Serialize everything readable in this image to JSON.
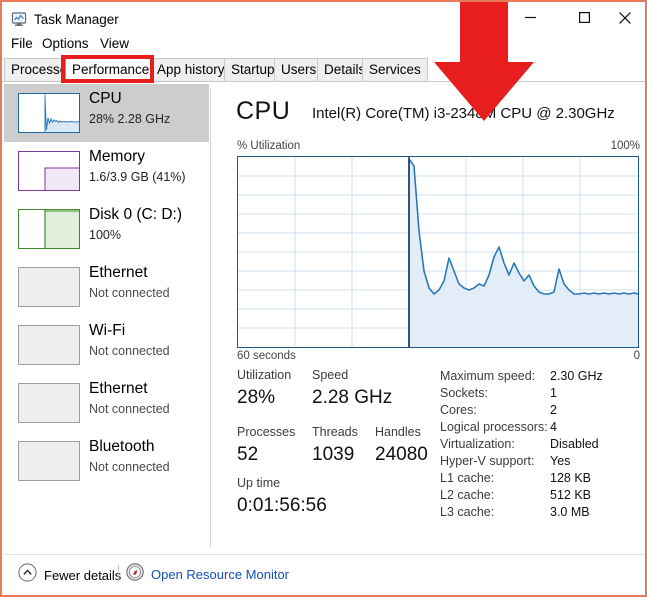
{
  "window": {
    "title": "Task Manager",
    "icon": "task-manager-icon",
    "border_color": "#e8795a",
    "controls": [
      {
        "name": "minimize",
        "glyph": "minimize-icon"
      },
      {
        "name": "maximize",
        "glyph": "maximize-icon"
      },
      {
        "name": "close",
        "glyph": "close-icon"
      }
    ]
  },
  "menubar": {
    "items": [
      {
        "label": "File"
      },
      {
        "label": "Options"
      },
      {
        "label": "View"
      }
    ]
  },
  "tabs": {
    "active": "Performance",
    "highlight_color": "#e81d1d",
    "items": [
      {
        "label": "Processes"
      },
      {
        "label": "Performance"
      },
      {
        "label": "App history"
      },
      {
        "label": "Startup"
      },
      {
        "label": "Users"
      },
      {
        "label": "Details"
      },
      {
        "label": "Services"
      }
    ]
  },
  "sidebar": {
    "items": [
      {
        "title": "CPU",
        "subtitle": "28%  2.28 GHz",
        "selected": true,
        "thumb": "cpu-graph-thumbnail",
        "accent": "#1f6aa5"
      },
      {
        "title": "Memory",
        "subtitle": "1.6/3.9 GB (41%)",
        "selected": false,
        "thumb": "memory-graph-thumbnail",
        "accent": "#7a3a99"
      },
      {
        "title": "Disk 0 (C: D:)",
        "subtitle": "100%",
        "selected": false,
        "thumb": "disk-graph-thumbnail",
        "accent": "#3f8a29"
      },
      {
        "title": "Ethernet",
        "subtitle": "Not connected",
        "selected": false,
        "thumb": "ethernet-graph-thumbnail",
        "accent": "#9d9d9d"
      },
      {
        "title": "Wi-Fi",
        "subtitle": "Not connected",
        "selected": false,
        "thumb": "wifi-graph-thumbnail",
        "accent": "#9d9d9d"
      },
      {
        "title": "Ethernet",
        "subtitle": "Not connected",
        "selected": false,
        "thumb": "ethernet-graph-thumbnail",
        "accent": "#9d9d9d"
      },
      {
        "title": "Bluetooth",
        "subtitle": "Not connected",
        "selected": false,
        "thumb": "bluetooth-graph-thumbnail",
        "accent": "#9d9d9d"
      }
    ]
  },
  "main": {
    "heading": "CPU",
    "model": "Intel(R) Core(TM) i3-2348M CPU @ 2.30GHz",
    "graph": {
      "axis_label": "% Utilization",
      "axis_max": "100%",
      "x_left": "60 seconds",
      "x_right": "0",
      "line_color": "#2a7ab8",
      "fill_color": "#e3edf8",
      "grid_color": "#cfe0ef",
      "border_color": "#1d5a8c"
    },
    "stats": [
      {
        "label": "Utilization",
        "value": "28%"
      },
      {
        "label": "Speed",
        "value": "2.28 GHz"
      },
      {
        "label": "Processes",
        "value": "52"
      },
      {
        "label": "Threads",
        "value": "1039"
      },
      {
        "label": "Handles",
        "value": "24080"
      },
      {
        "label": "Up time",
        "value": "0:01:56:56"
      }
    ],
    "specs": [
      {
        "key": "Maximum speed:",
        "value": "2.30 GHz"
      },
      {
        "key": "Sockets:",
        "value": "1"
      },
      {
        "key": "Cores:",
        "value": "2"
      },
      {
        "key": "Logical processors:",
        "value": "4"
      },
      {
        "key": "Virtualization:",
        "value": "Disabled"
      },
      {
        "key": "Hyper-V support:",
        "value": "Yes"
      },
      {
        "key": "L1 cache:",
        "value": "128 KB"
      },
      {
        "key": "L2 cache:",
        "value": "512 KB"
      },
      {
        "key": "L3 cache:",
        "value": "3.0 MB"
      }
    ]
  },
  "bottombar": {
    "fewer_details": "Fewer details",
    "fewer_details_icon": "chevron-up-circle-icon",
    "resource_monitor": "Open Resource Monitor",
    "resource_monitor_icon": "resource-monitor-icon",
    "link_color": "#1450b4"
  },
  "annotation": {
    "arrow": "red-down-arrow",
    "color": "#e81d1d"
  },
  "chart_data": {
    "type": "area",
    "title": "CPU % Utilization",
    "xlabel": "seconds",
    "ylabel": "% Utilization",
    "ylim": [
      0,
      100
    ],
    "xlim": [
      60,
      0
    ],
    "grid": true,
    "legend": "none",
    "note": "History begins ~34 s ago; flat zero before that.",
    "x": [
      60,
      59,
      58,
      57,
      56,
      55,
      54,
      53,
      52,
      51,
      50,
      49,
      48,
      47,
      46,
      45,
      44,
      43,
      42,
      41,
      40,
      39,
      38,
      37,
      36,
      35,
      34,
      33,
      32,
      31,
      30,
      29,
      28,
      27,
      26,
      25,
      24,
      23,
      22,
      21,
      20,
      19,
      18,
      17,
      16,
      15,
      14,
      13,
      12,
      11,
      10,
      9,
      8,
      7,
      6,
      5,
      4,
      3,
      2,
      1,
      0
    ],
    "values": [
      0,
      0,
      0,
      0,
      0,
      0,
      0,
      0,
      0,
      0,
      0,
      0,
      0,
      0,
      0,
      0,
      0,
      0,
      0,
      0,
      0,
      0,
      0,
      0,
      0,
      0,
      100,
      96,
      62,
      40,
      31,
      28,
      30,
      35,
      48,
      40,
      33,
      31,
      30,
      31,
      33,
      32,
      38,
      47,
      53,
      44,
      38,
      44,
      39,
      35,
      38,
      32,
      29,
      28,
      28,
      29,
      41,
      33,
      30,
      28,
      28
    ]
  }
}
